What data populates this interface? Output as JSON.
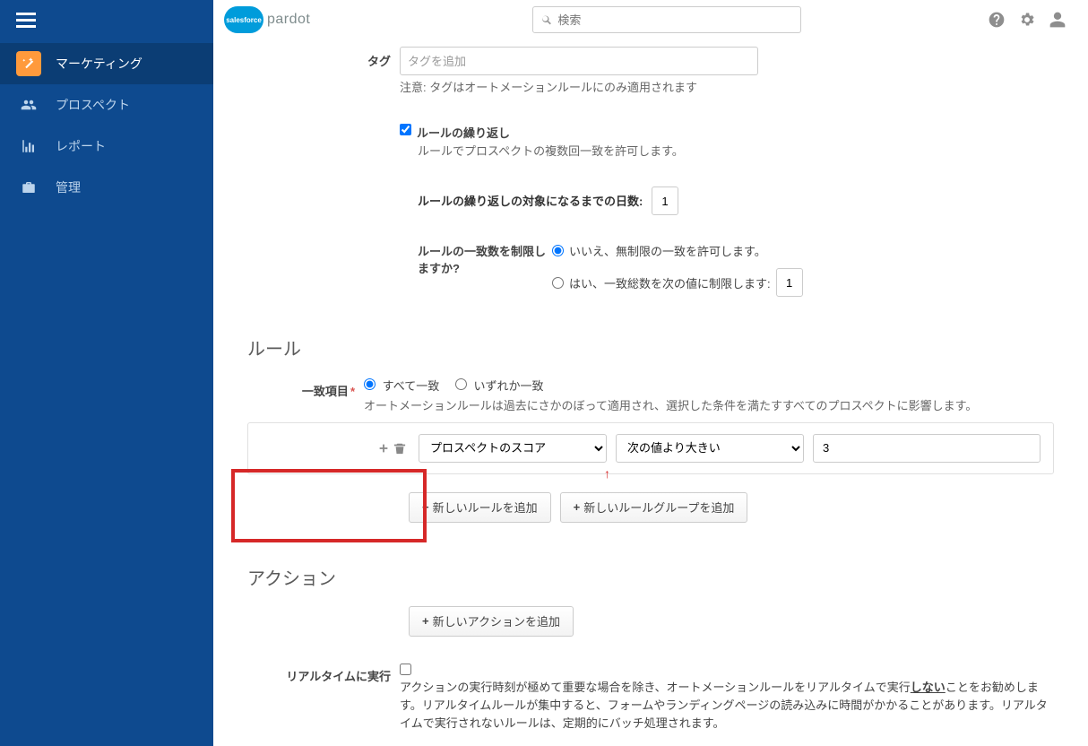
{
  "topbar": {
    "logo_cloud": "salesforce",
    "logo_word": "pardot",
    "search_placeholder": "検索"
  },
  "sidebar": {
    "items": [
      {
        "label": "マーケティング"
      },
      {
        "label": "プロスペクト"
      },
      {
        "label": "レポート"
      },
      {
        "label": "管理"
      }
    ]
  },
  "form": {
    "tag_label": "タグ",
    "tag_placeholder": "タグを追加",
    "tag_note": "注意: タグはオートメーションルールにのみ適用されます",
    "repeat_label": "ルールの繰り返し",
    "repeat_hint": "ルールでプロスペクトの複数回一致を許可します。",
    "days_label": "ルールの繰り返しの対象になるまでの日数:",
    "days_value": "1",
    "limit_label": "ルールの一致数を制限しますか?",
    "limit_no": "いいえ、無制限の一致を許可します。",
    "limit_yes": "はい、一致総数を次の値に制限します:",
    "limit_yes_value": "1"
  },
  "rules": {
    "heading": "ルール",
    "match_label": "一致項目",
    "match_all": "すべて一致",
    "match_any": "いずれか一致",
    "match_hint": "オートメーションルールは過去にさかのぼって適用され、選択した条件を満たすすべてのプロスペクトに影響します。",
    "rule_sel1": "プロスペクトのスコア",
    "rule_sel2": "次の値より大きい",
    "rule_val": "3",
    "add_rule": "新しいルールを追加",
    "add_group": "新しいルールグループを追加"
  },
  "actions": {
    "heading": "アクション",
    "add_action": "新しいアクションを追加",
    "realtime_label": "リアルタイムに実行",
    "realtime_p1": "アクションの実行時刻が極めて重要な場合を除き、オートメーションルールをリアルタイムで実行",
    "realtime_p1_em": "しない",
    "realtime_p1_b": "ことをお勧めします。リアルタイムルールが集中すると、フォームやランディングページの読み込みに時間がかかることがあります。リアルタイムで実行されないルールは、定期的にバッチ処理されます。"
  }
}
